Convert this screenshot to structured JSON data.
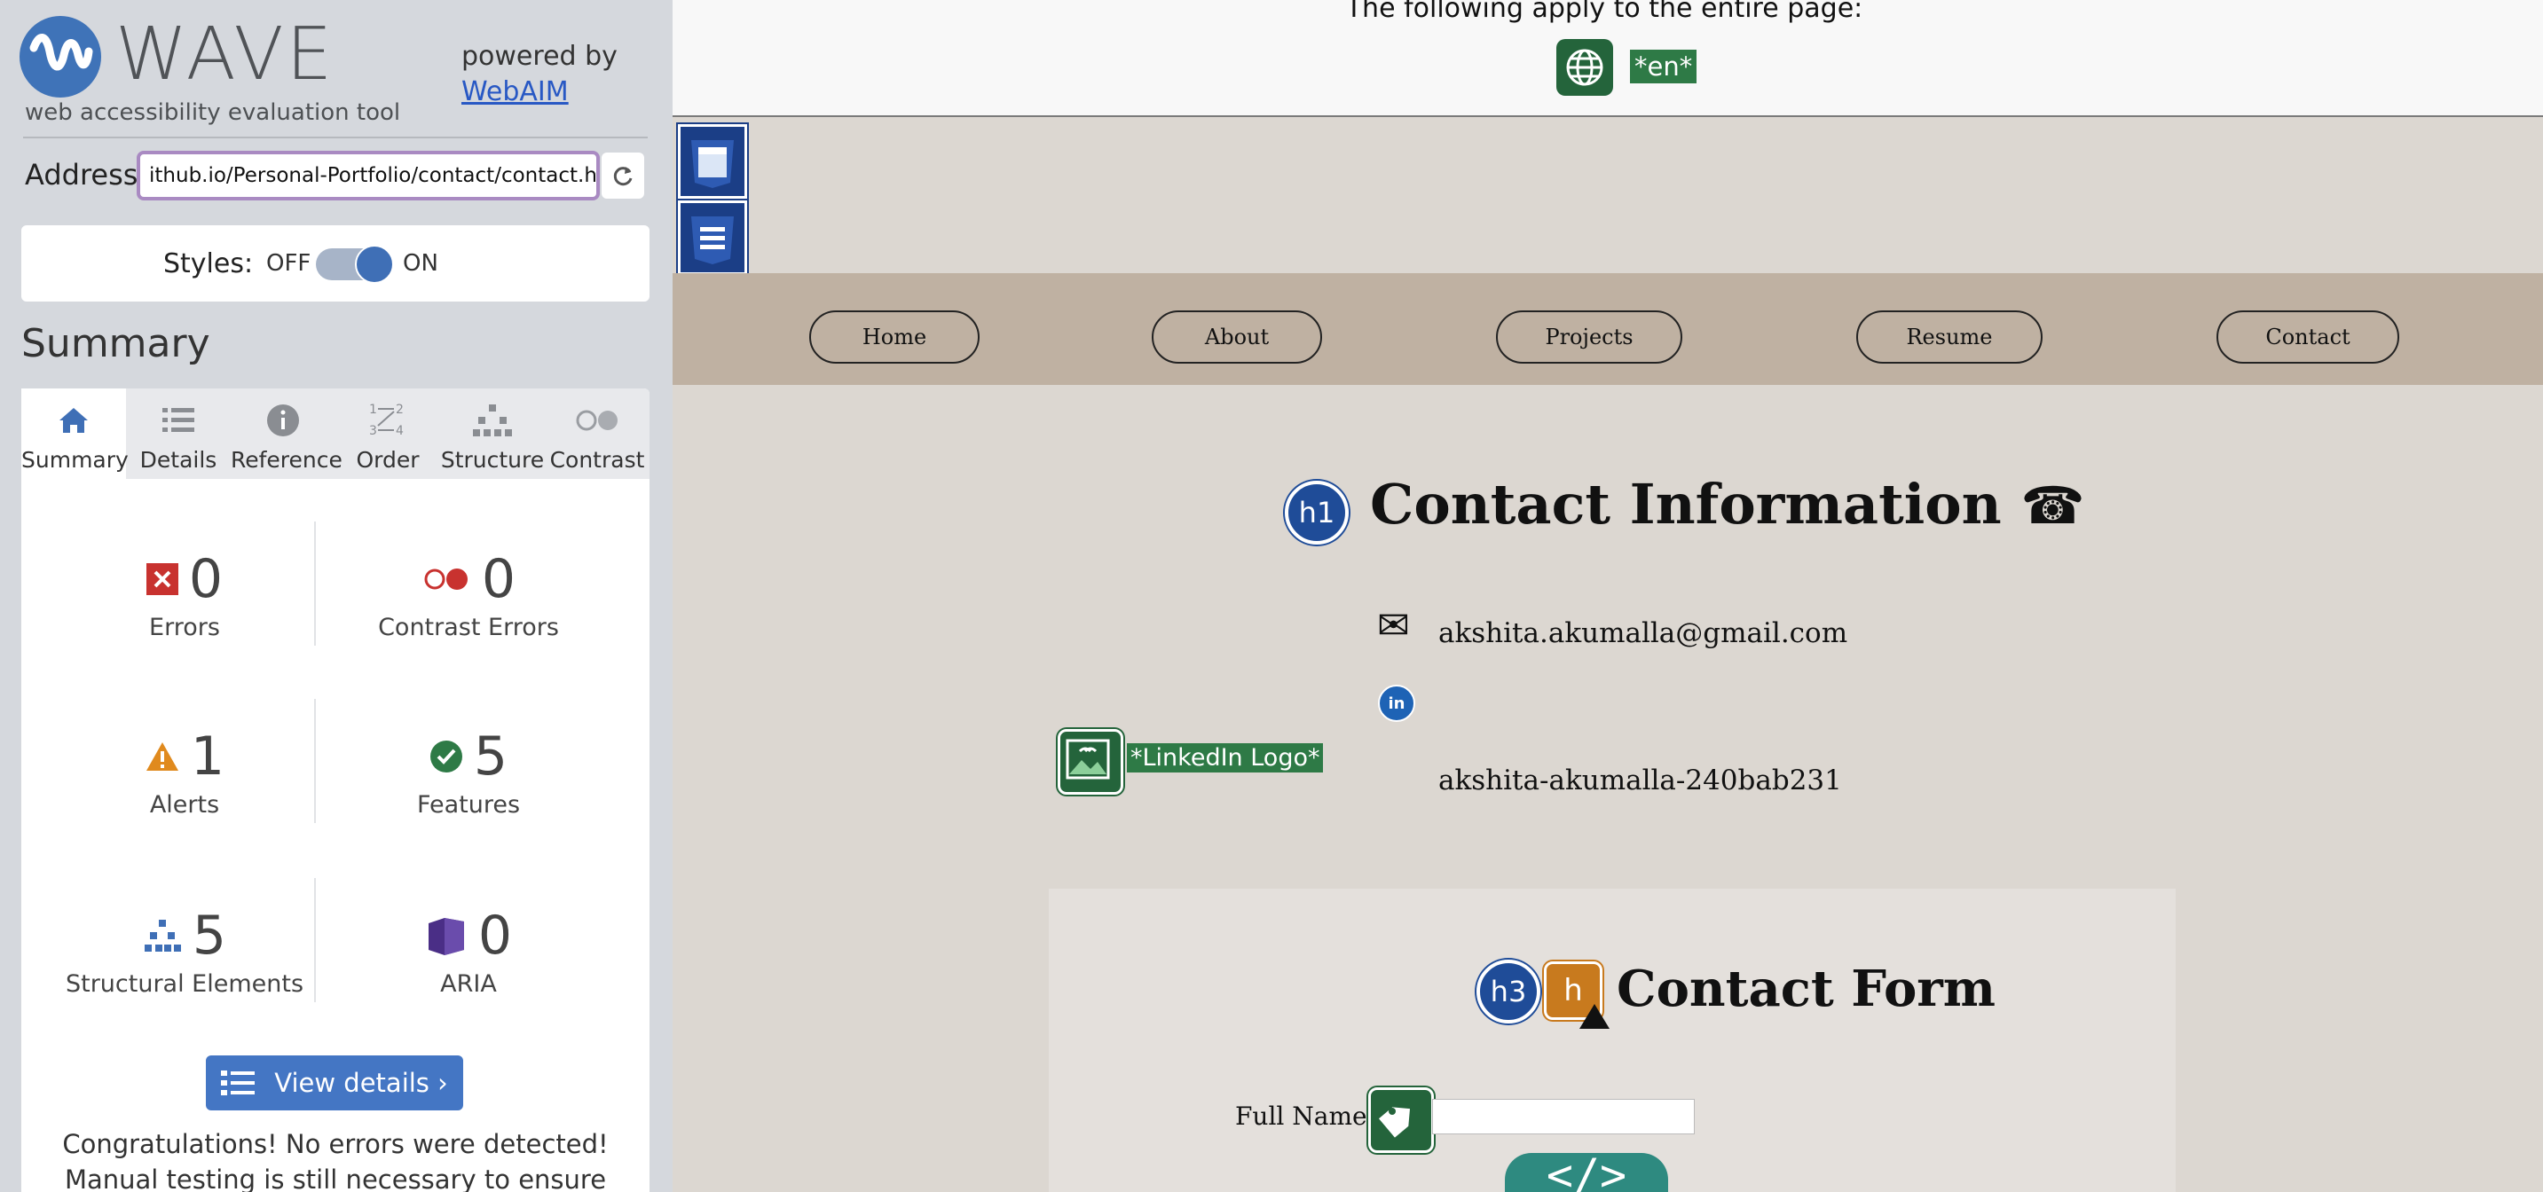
{
  "wave": {
    "title": "WAVE",
    "subtitle": "web accessibility evaluation tool",
    "powered_by": "powered by",
    "webaim_link": "WebAIM",
    "address_label": "Address:",
    "address_value": "ithub.io/Personal-Portfolio/contact/contact.html",
    "styles_label": "Styles:",
    "styles_off": "OFF",
    "styles_on": "ON",
    "styles_state": "on",
    "summary_heading": "Summary",
    "tabs": [
      {
        "label": "Summary",
        "icon": "home-icon"
      },
      {
        "label": "Details",
        "icon": "list-icon"
      },
      {
        "label": "Reference",
        "icon": "info-icon"
      },
      {
        "label": "Order",
        "icon": "order-icon"
      },
      {
        "label": "Structure",
        "icon": "structure-icon"
      },
      {
        "label": "Contrast",
        "icon": "contrast-icon"
      }
    ],
    "stats": {
      "errors": {
        "count": "0",
        "label": "Errors"
      },
      "contrast_errors": {
        "count": "0",
        "label": "Contrast Errors"
      },
      "alerts": {
        "count": "1",
        "label": "Alerts"
      },
      "features": {
        "count": "5",
        "label": "Features"
      },
      "structural": {
        "count": "5",
        "label": "Structural Elements"
      },
      "aria": {
        "count": "0",
        "label": "ARIA"
      }
    },
    "view_details": "View details ›",
    "congrats": "Congratulations! No errors were detected! Manual testing is still necessary to ensure compliance and"
  },
  "page": {
    "banner_text": "The following apply to the entire page:",
    "lang_tag": "*en*",
    "nav": [
      "Home",
      "About",
      "Projects",
      "Resume",
      "Contact"
    ],
    "h1_badge": "h1",
    "contact_title": "Contact Information",
    "phone_glyph": "☎",
    "email": "akshita.akumalla@gmail.com",
    "linkedin_small": "in",
    "linkedin_alt": "*LinkedIn Logo*",
    "linkedin_handle": "akshita-akumalla-240bab231",
    "h3_badge": "h3",
    "alert_badge": "h",
    "form_title": "Contact Form",
    "fullname_label": "Full Name:",
    "code_icon": "</>"
  },
  "colors": {
    "wave_blue": "#3f73b8",
    "feature_green": "#24643b",
    "structure_navy": "#1b3e86",
    "alert_orange": "#c87a1e",
    "nav_bar": "#bfb1a2",
    "page_bg": "#dcd7d1"
  }
}
